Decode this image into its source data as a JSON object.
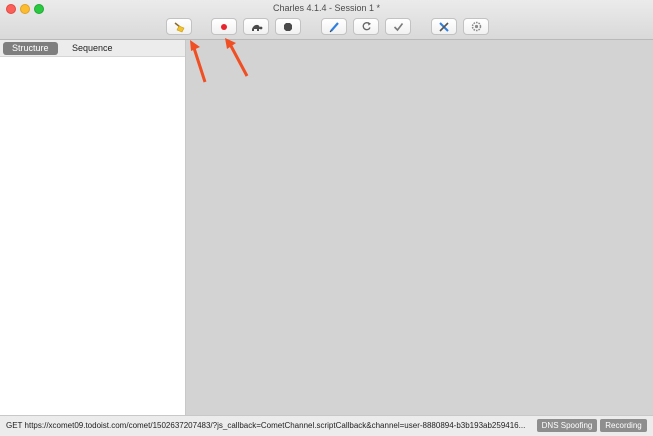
{
  "window": {
    "title": "Charles 4.1.4 - Session 1 *"
  },
  "toolbar": {
    "buttons": [
      {
        "name": "clear-session-button",
        "icon": "broom-icon"
      },
      {
        "name": "record-button",
        "icon": "record-dot-icon",
        "color": "#e8232d"
      },
      {
        "name": "throttle-button",
        "icon": "turtle-icon"
      },
      {
        "name": "breakpoints-button",
        "icon": "stop-hexagon-icon"
      },
      {
        "name": "compose-button",
        "icon": "pen-icon",
        "color": "#2f7fe0"
      },
      {
        "name": "repeat-button",
        "icon": "refresh-icon"
      },
      {
        "name": "validate-button",
        "icon": "checkmark-icon"
      },
      {
        "name": "tools-button",
        "icon": "tools-icon"
      },
      {
        "name": "settings-button",
        "icon": "gear-icon"
      }
    ]
  },
  "sidebar": {
    "tabs": [
      {
        "label": "Structure",
        "active": true
      },
      {
        "label": "Sequence",
        "active": false
      }
    ]
  },
  "statusbar": {
    "request": "GET https://xcomet09.todoist.com/comet/1502637207483/?js_callback=CometChannel.scriptCallback&channel=user-8880894-b3b193ab259416...",
    "dns_spoofing": "DNS Spoofing",
    "recording": "Recording"
  },
  "colors": {
    "accent_arrow": "#f04e23",
    "record": "#e8232d"
  }
}
